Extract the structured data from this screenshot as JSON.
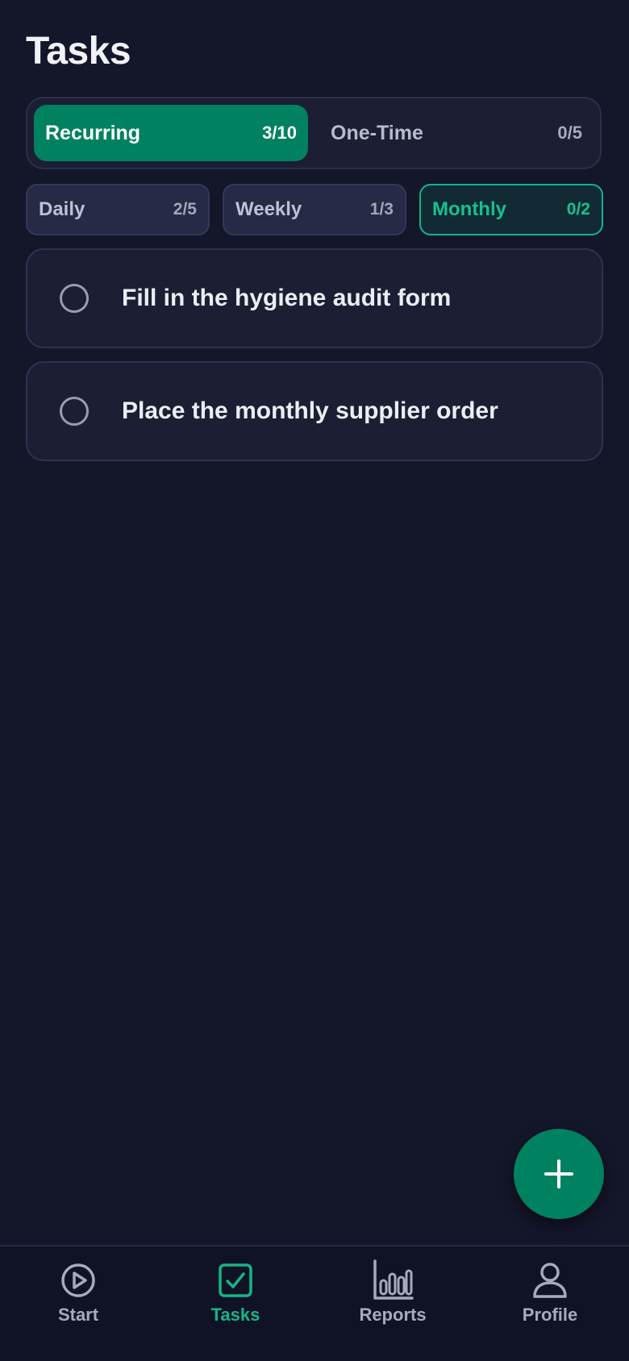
{
  "page": {
    "title": "Tasks"
  },
  "segments": [
    {
      "label": "Recurring",
      "count": "3/10",
      "active": true
    },
    {
      "label": "One-Time",
      "count": "0/5",
      "active": false
    }
  ],
  "filters": [
    {
      "label": "Daily",
      "count": "2/5",
      "active": false
    },
    {
      "label": "Weekly",
      "count": "1/3",
      "active": false
    },
    {
      "label": "Monthly",
      "count": "0/2",
      "active": true
    }
  ],
  "tasks": [
    {
      "text": "Fill in the hygiene audit form",
      "done": false
    },
    {
      "text": "Place the monthly supplier order",
      "done": false
    }
  ],
  "fab": {
    "icon": "plus-icon"
  },
  "nav": [
    {
      "label": "Start",
      "icon": "play-circle-icon",
      "active": false
    },
    {
      "label": "Tasks",
      "icon": "checkbox-icon",
      "active": true
    },
    {
      "label": "Reports",
      "icon": "bar-chart-icon",
      "active": false
    },
    {
      "label": "Profile",
      "icon": "user-icon",
      "active": false
    }
  ],
  "colors": {
    "background": "#14162a",
    "accent": "#008160",
    "accent_text": "#15b587",
    "card": "#1c1e33"
  }
}
